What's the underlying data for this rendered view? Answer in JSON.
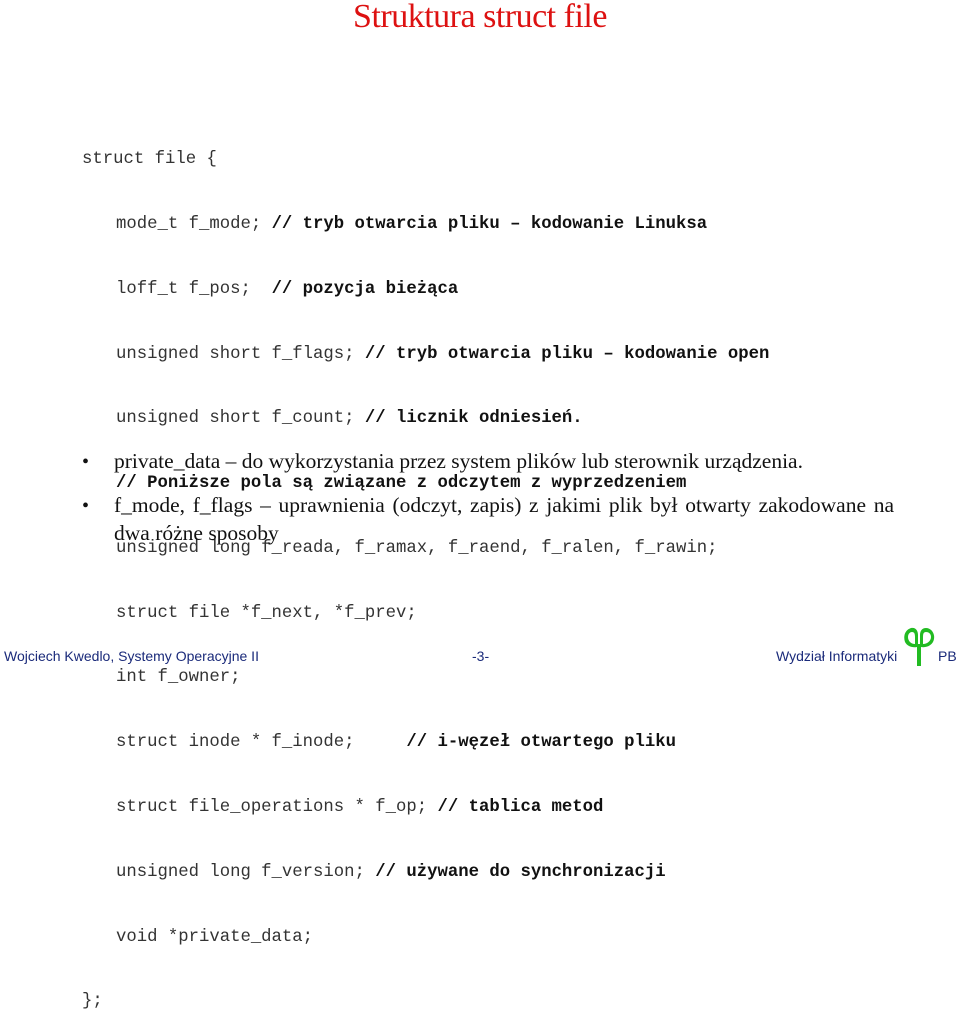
{
  "title": "Struktura struct file",
  "code": {
    "lines": [
      {
        "code": "struct file {",
        "comment": "",
        "indent": false
      },
      {
        "code": "mode_t f_mode; ",
        "comment": "// tryb otwarcia pliku – kodowanie Linuksa",
        "indent": true
      },
      {
        "code": "loff_t f_pos;  ",
        "comment": "// pozycja bieżąca",
        "indent": true
      },
      {
        "code": "unsigned short f_flags; ",
        "comment": "// tryb otwarcia pliku – kodowanie open",
        "indent": true
      },
      {
        "code": "unsigned short f_count; ",
        "comment": "// licznik odniesień.",
        "indent": true
      },
      {
        "code": "",
        "comment": "// Poniższe pola są związane z odczytem z wyprzedzeniem",
        "indent": true
      },
      {
        "code": "unsigned long f_reada, f_ramax, f_raend, f_ralen, f_rawin;",
        "comment": "",
        "indent": true
      },
      {
        "code": "struct file *f_next, *f_prev;",
        "comment": "",
        "indent": true
      },
      {
        "code": "int f_owner;",
        "comment": "",
        "indent": true
      },
      {
        "code": "struct inode * f_inode;     ",
        "comment": "// i-węzeł otwartego pliku",
        "indent": true
      },
      {
        "code": "struct file_operations * f_op; ",
        "comment": "// tablica metod",
        "indent": true
      },
      {
        "code": "unsigned long f_version; ",
        "comment": "// używane do synchronizacji",
        "indent": true
      },
      {
        "code": "void *private_data;",
        "comment": "",
        "indent": true
      },
      {
        "code": "};",
        "comment": "",
        "indent": false
      }
    ]
  },
  "bullets": [
    {
      "marker": "•",
      "text": "private_data – do wykorzystania przez system plików lub sterownik urządzenia."
    },
    {
      "marker": "•",
      "text": "f_mode, f_flags – uprawnienia (odczyt, zapis) z jakimi plik był otwarty zakodowane na dwa różne sposoby"
    }
  ],
  "footer": {
    "author_course": "Wojciech Kwedlo, Systemy Operacyjne II",
    "page": "-3-",
    "faculty": "Wydział Informatyki",
    "university_abbr": "PB",
    "logo_icon": "pb-logo-icon",
    "logo_color": "#22bb22"
  },
  "colors": {
    "title": "#dd1111",
    "footer_text": "#1a2a7a"
  }
}
